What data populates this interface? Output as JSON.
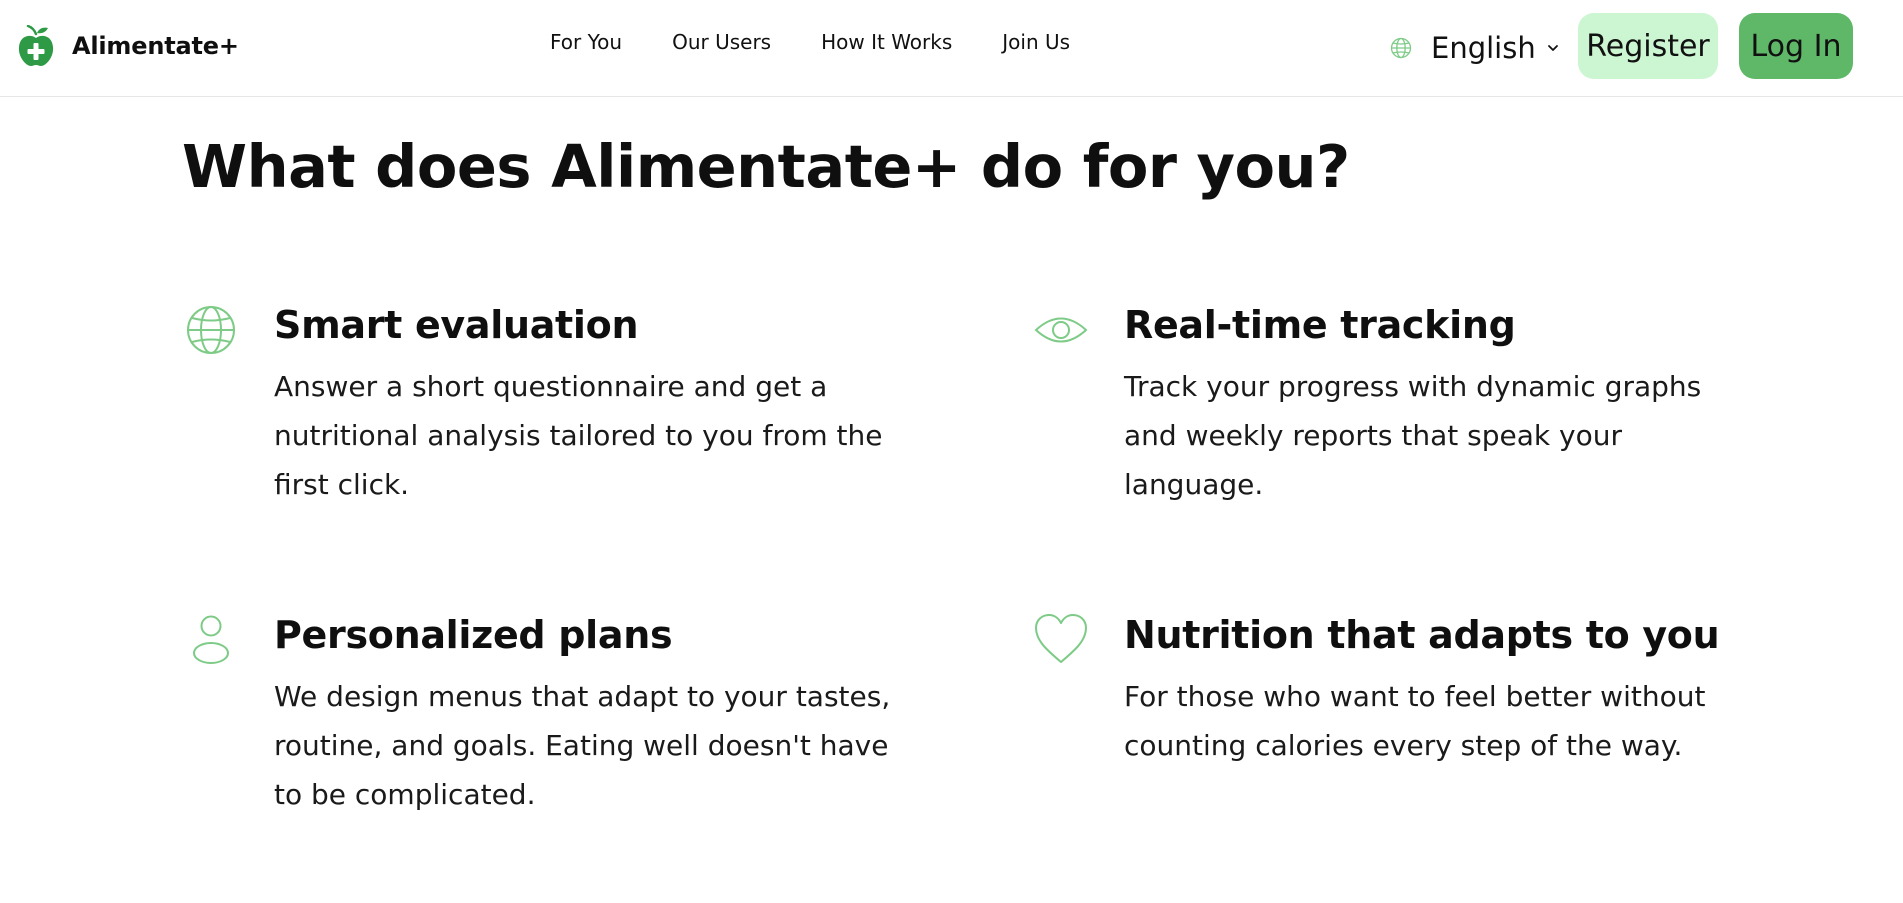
{
  "brand": {
    "name": "Alimentate+",
    "logo_icon": "apple-plus-icon"
  },
  "nav": {
    "items": [
      {
        "label": "For You"
      },
      {
        "label": "Our Users"
      },
      {
        "label": "How It Works"
      },
      {
        "label": "Join Us"
      }
    ]
  },
  "language": {
    "selected": "English",
    "icon": "globe-icon"
  },
  "auth": {
    "register_label": "Register",
    "login_label": "Log In"
  },
  "main": {
    "title": "What does Alimentate+ do for you?",
    "features": [
      {
        "icon": "globe-icon",
        "title": "Smart evaluation",
        "description": "Answer a short questionnaire and get a nutritional analysis tailored to you from the first click."
      },
      {
        "icon": "eye-icon",
        "title": "Real-time tracking",
        "description": "Track your progress with dynamic graphs and weekly reports that speak your language."
      },
      {
        "icon": "user-icon",
        "title": "Personalized plans",
        "description": "We design menus that adapt to your tastes, routine, and goals. Eating well doesn't have to be complicated."
      },
      {
        "icon": "heart-icon",
        "title": "Nutrition that adapts to you",
        "description": "For those who want to feel better without counting calories every step of the way."
      }
    ]
  },
  "colors": {
    "accent_green": "#5eb868",
    "light_green": "#ccf5d1",
    "icon_green": "#7dcb86",
    "logo_green": "#2f9a45"
  }
}
